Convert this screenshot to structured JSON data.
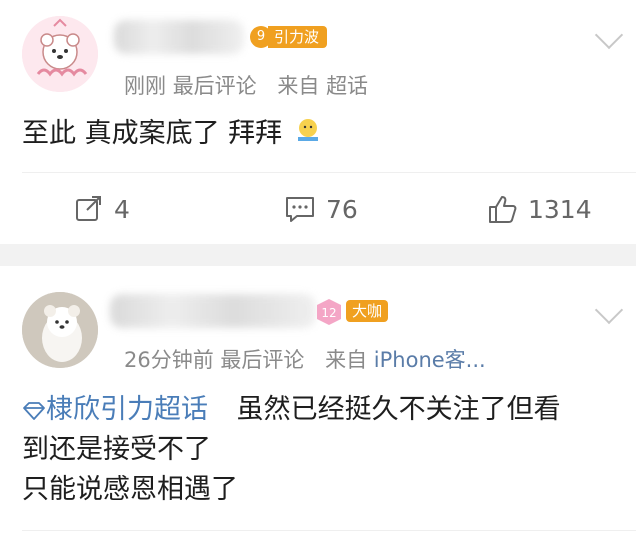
{
  "post1": {
    "badge_label": "引力波",
    "badge_level": "9",
    "meta": {
      "time": "刚刚",
      "last_comment": "最后评论",
      "source_prefix": "来自",
      "source": "超话"
    },
    "text": "至此 真成案底了 拜拜",
    "actions": {
      "repost_count": "4",
      "comment_count": "76",
      "like_count": "1314"
    }
  },
  "post2": {
    "level_badge": "12",
    "badge_label": "大咖",
    "meta": {
      "time": "26分钟前",
      "last_comment": "最后评论",
      "source_prefix": "来自",
      "source": "iPhone客..."
    },
    "topic_tag": "棣欣引力超话",
    "text_line1_suffix": "虽然已经挺久不关注了但看",
    "text_line2": "到还是接受不了",
    "text_line3": "只能说感恩相遇了"
  },
  "colors": {
    "badge_orange": "#f0a020",
    "topic_blue": "#4a7db8",
    "meta_gray": "#8a8a8a",
    "separator": "#f2f2f2"
  },
  "icons": [
    "repost-icon",
    "comment-icon",
    "like-icon",
    "chevron-down-icon",
    "diamond-icon",
    "emoji-icon"
  ]
}
